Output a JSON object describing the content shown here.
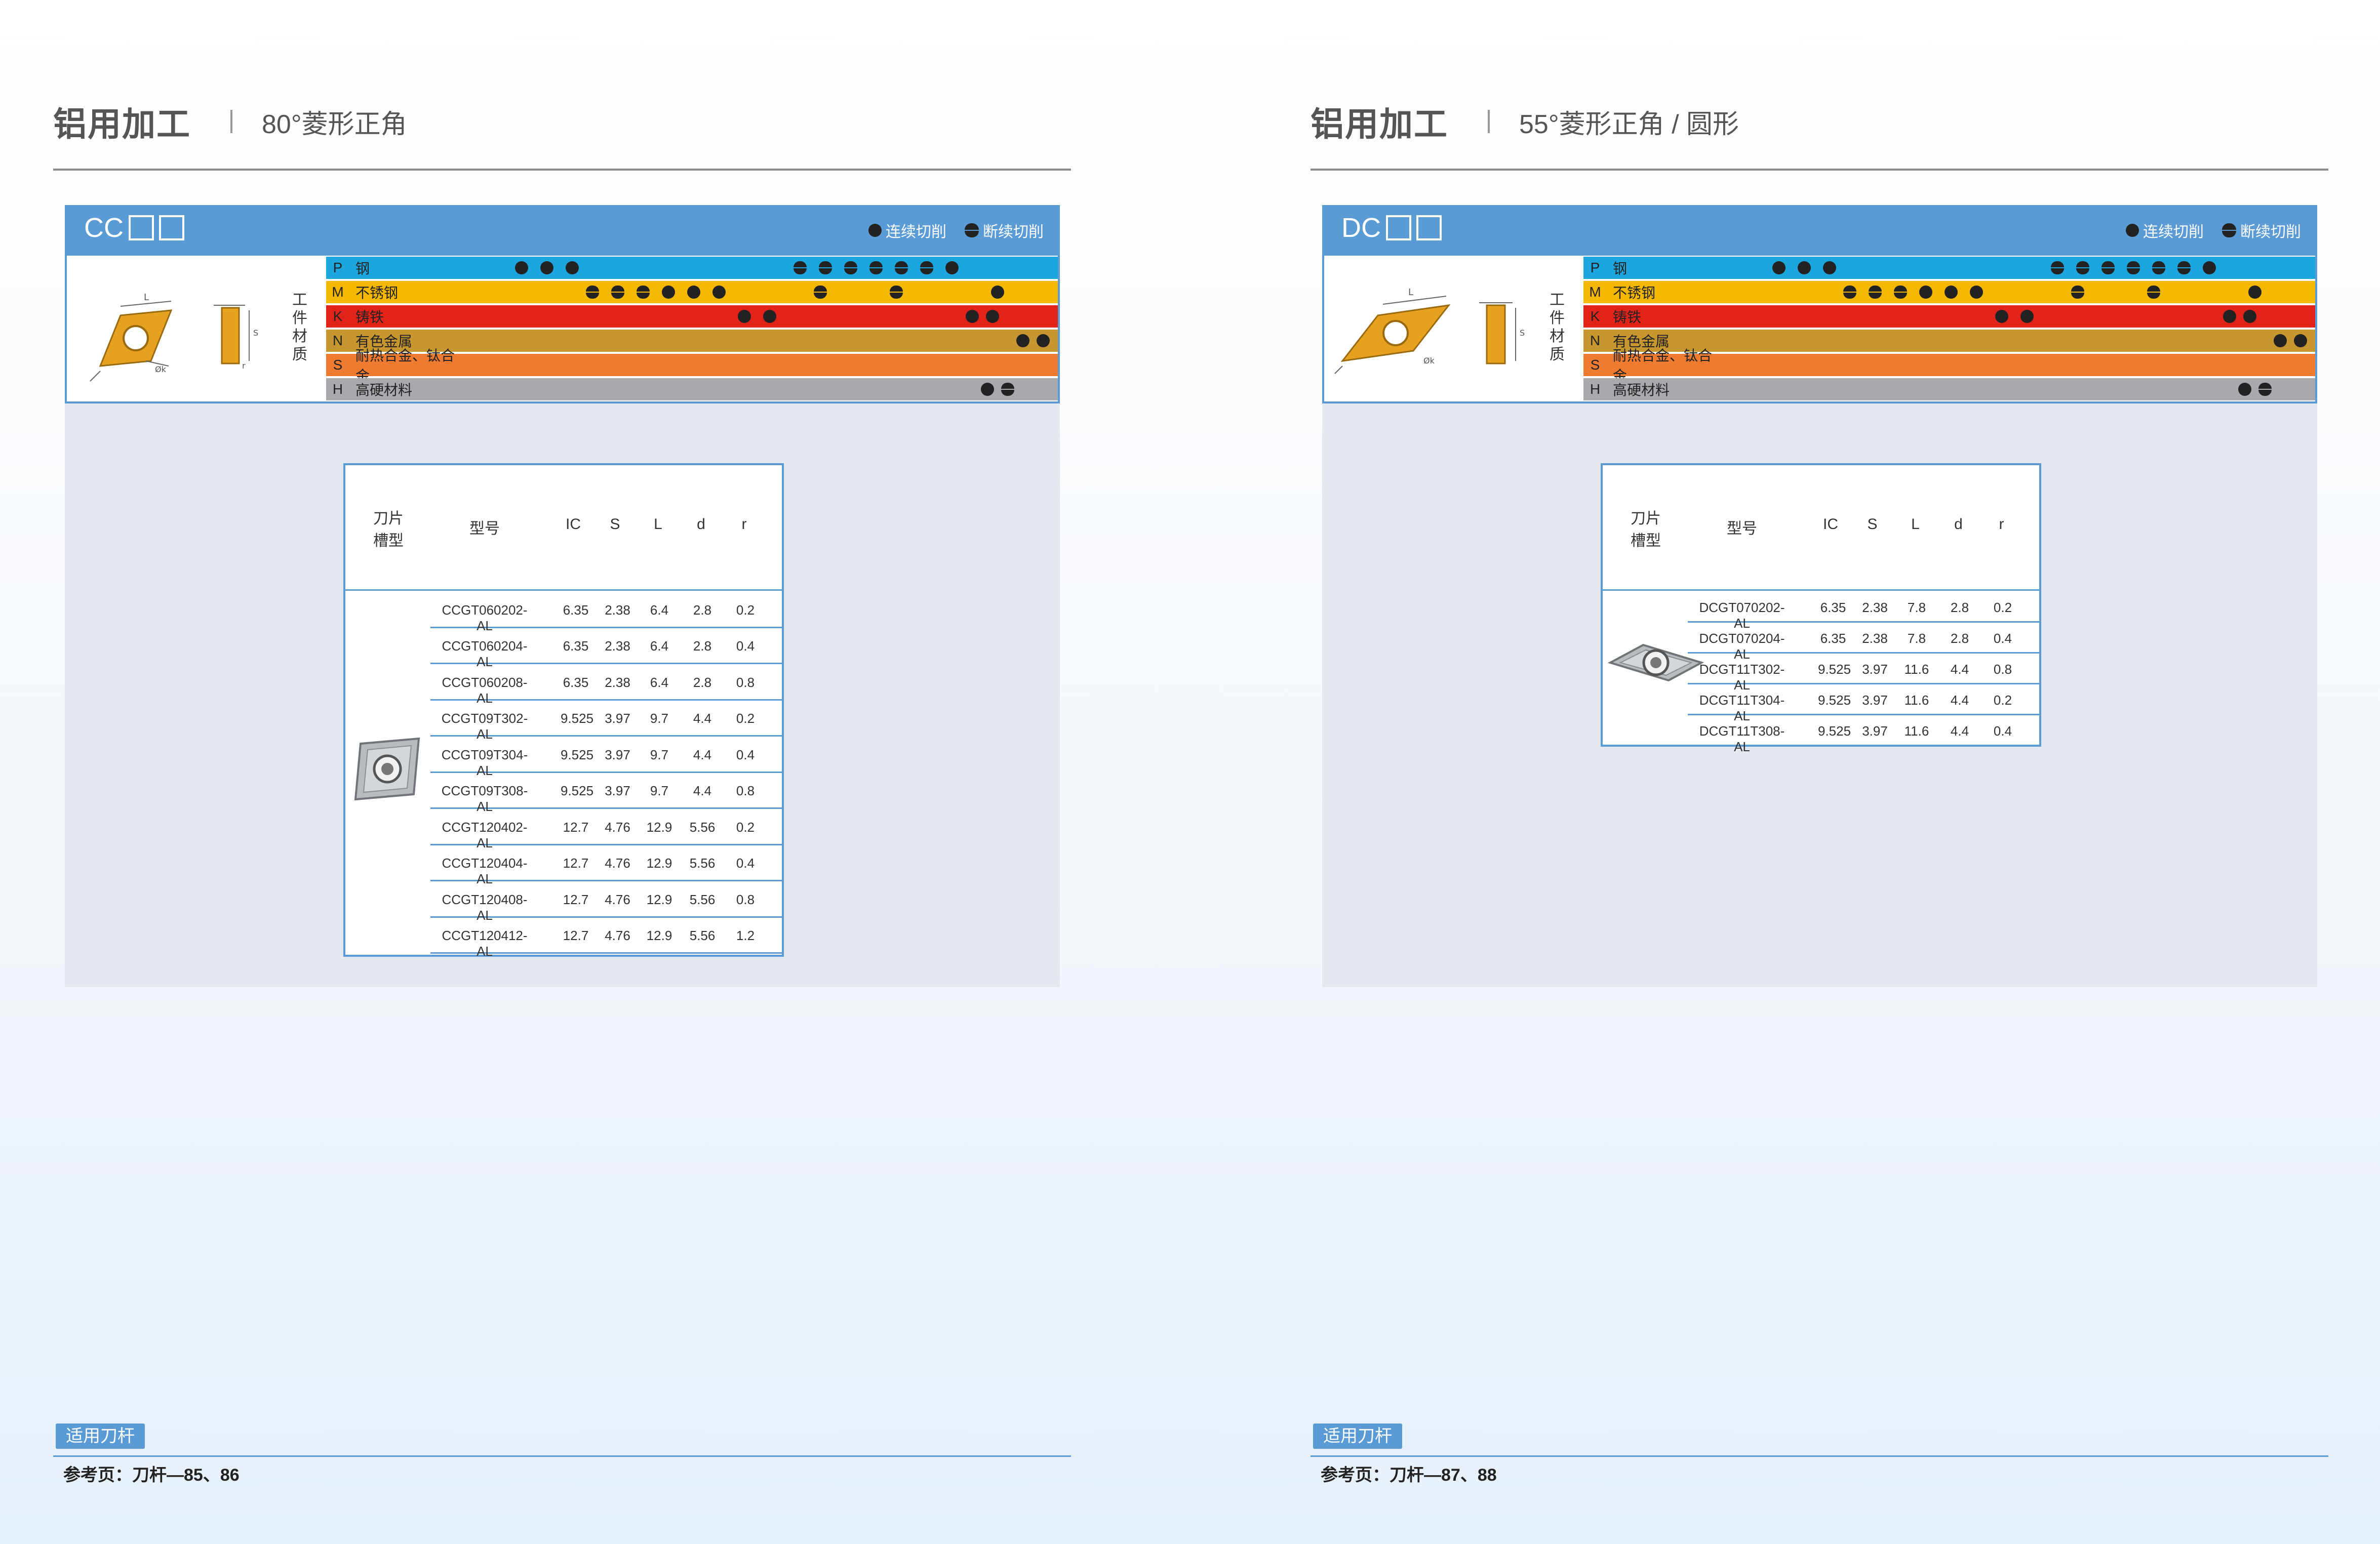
{
  "left": {
    "title": "铝用加工",
    "subtitle": "80°菱形正角",
    "series_prefix": "CC",
    "legend": {
      "continuous": "连续切削",
      "interrupted": "断续切削"
    },
    "workpiece_label": [
      "工",
      "件",
      "材",
      "质"
    ],
    "materials": [
      {
        "code": "P",
        "name": "钢",
        "color": "#1da6de"
      },
      {
        "code": "M",
        "name": "不锈钢",
        "color": "#f5b800"
      },
      {
        "code": "K",
        "name": "铸铁",
        "color": "#e2231a"
      },
      {
        "code": "N",
        "name": "有色金属",
        "color": "#c7962f"
      },
      {
        "code": "S",
        "name": "耐热合金、钛合金",
        "color": "#ee7b30"
      },
      {
        "code": "H",
        "name": "高硬材料",
        "color": "#a7a9ac"
      }
    ],
    "table": {
      "headers": {
        "groove": "刀片\n槽型",
        "model": "型号",
        "ic": "IC",
        "s": "S",
        "l": "L",
        "d": "d",
        "r": "r"
      },
      "rows": [
        [
          "CCGT060202-AL",
          "6.35",
          "2.38",
          "6.4",
          "2.8",
          "0.2"
        ],
        [
          "CCGT060204-AL",
          "6.35",
          "2.38",
          "6.4",
          "2.8",
          "0.4"
        ],
        [
          "CCGT060208-AL",
          "6.35",
          "2.38",
          "6.4",
          "2.8",
          "0.8"
        ],
        [
          "CCGT09T302-AL",
          "9.525",
          "3.97",
          "9.7",
          "4.4",
          "0.2"
        ],
        [
          "CCGT09T304-AL",
          "9.525",
          "3.97",
          "9.7",
          "4.4",
          "0.4"
        ],
        [
          "CCGT09T308-AL",
          "9.525",
          "3.97",
          "9.7",
          "4.4",
          "0.8"
        ],
        [
          "CCGT120402-AL",
          "12.7",
          "4.76",
          "12.9",
          "5.56",
          "0.2"
        ],
        [
          "CCGT120404-AL",
          "12.7",
          "4.76",
          "12.9",
          "5.56",
          "0.4"
        ],
        [
          "CCGT120408-AL",
          "12.7",
          "4.76",
          "12.9",
          "5.56",
          "0.8"
        ],
        [
          "CCGT120412-AL",
          "12.7",
          "4.76",
          "12.9",
          "5.56",
          "1.2"
        ]
      ]
    },
    "footer": {
      "tag": "适用刀杆",
      "ref": "参考页：刀杆—85、86"
    }
  },
  "right": {
    "title": "铝用加工",
    "subtitle": "55°菱形正角 / 圆形",
    "series_prefix": "DC",
    "legend": {
      "continuous": "连续切削",
      "interrupted": "断续切削"
    },
    "workpiece_label": [
      "工",
      "件",
      "材",
      "质"
    ],
    "materials": [
      {
        "code": "P",
        "name": "钢",
        "color": "#1da6de"
      },
      {
        "code": "M",
        "name": "不锈钢",
        "color": "#f5b800"
      },
      {
        "code": "K",
        "name": "铸铁",
        "color": "#e2231a"
      },
      {
        "code": "N",
        "name": "有色金属",
        "color": "#c7962f"
      },
      {
        "code": "S",
        "name": "耐热合金、钛合金",
        "color": "#ee7b30"
      },
      {
        "code": "H",
        "name": "高硬材料",
        "color": "#a7a9ac"
      }
    ],
    "table": {
      "headers": {
        "groove": "刀片\n槽型",
        "model": "型号",
        "ic": "IC",
        "s": "S",
        "l": "L",
        "d": "d",
        "r": "r"
      },
      "rows": [
        [
          "DCGT070202-AL",
          "6.35",
          "2.38",
          "7.8",
          "2.8",
          "0.2"
        ],
        [
          "DCGT070204-AL",
          "6.35",
          "2.38",
          "7.8",
          "2.8",
          "0.4"
        ],
        [
          "DCGT11T302-AL",
          "9.525",
          "3.97",
          "11.6",
          "4.4",
          "0.8"
        ],
        [
          "DCGT11T304-AL",
          "9.525",
          "3.97",
          "11.6",
          "4.4",
          "0.2"
        ],
        [
          "DCGT11T308-AL",
          "9.525",
          "3.97",
          "11.6",
          "4.4",
          "0.4"
        ]
      ]
    },
    "footer": {
      "tag": "适用刀杆",
      "ref": "参考页：刀杆—87、88"
    }
  }
}
